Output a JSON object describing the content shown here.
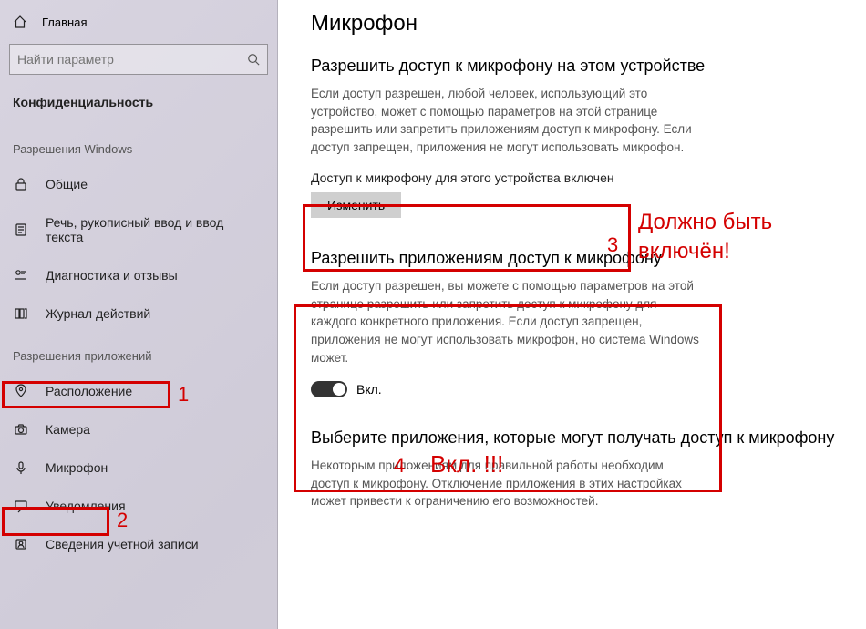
{
  "sidebar": {
    "home": "Главная",
    "search_placeholder": "Найти параметр",
    "section_title": "Конфиденциальность",
    "group1_label": "Разрешения Windows",
    "group2_label": "Разрешения приложений",
    "items_g1": [
      {
        "label": "Общие"
      },
      {
        "label": "Речь, рукописный ввод и ввод текста"
      },
      {
        "label": "Диагностика и отзывы"
      },
      {
        "label": "Журнал действий"
      }
    ],
    "items_g2": [
      {
        "label": "Расположение"
      },
      {
        "label": "Камера"
      },
      {
        "label": "Микрофон"
      },
      {
        "label": "Уведомления"
      },
      {
        "label": "Сведения учетной записи"
      }
    ]
  },
  "main": {
    "title": "Микрофон",
    "s1_title": "Разрешить доступ к микрофону на этом устройстве",
    "s1_desc": "Если доступ разрешен, любой человек, использующий это устройство, может с помощью параметров на этой странице разрешить или запретить приложениям доступ к микрофону. Если доступ запрещен, приложения не могут использовать микрофон.",
    "s1_status": "Доступ к микрофону для этого устройства включен",
    "s1_button": "Изменить",
    "s2_title": "Разрешить приложениям доступ к микрофону",
    "s2_desc": "Если доступ разрешен, вы можете с помощью параметров на этой странице разрешить или запретить доступ к микрофону для каждого конкретного приложения. Если доступ запрещен, приложения не могут использовать микрофон, но система Windows может.",
    "s2_toggle_label": "Вкл.",
    "s3_title": "Выберите приложения, которые могут получать доступ к микрофону",
    "s3_desc": "Некоторым приложениям для правильной работы необходим доступ к микрофону. Отключение приложения в этих настройках может привести к ограничению его возможностей."
  },
  "annotations": {
    "n1": "1",
    "n2": "2",
    "n3": "3",
    "n4": "4",
    "t4": "Вкл. !!!",
    "tright": "Должно быть включён!"
  }
}
